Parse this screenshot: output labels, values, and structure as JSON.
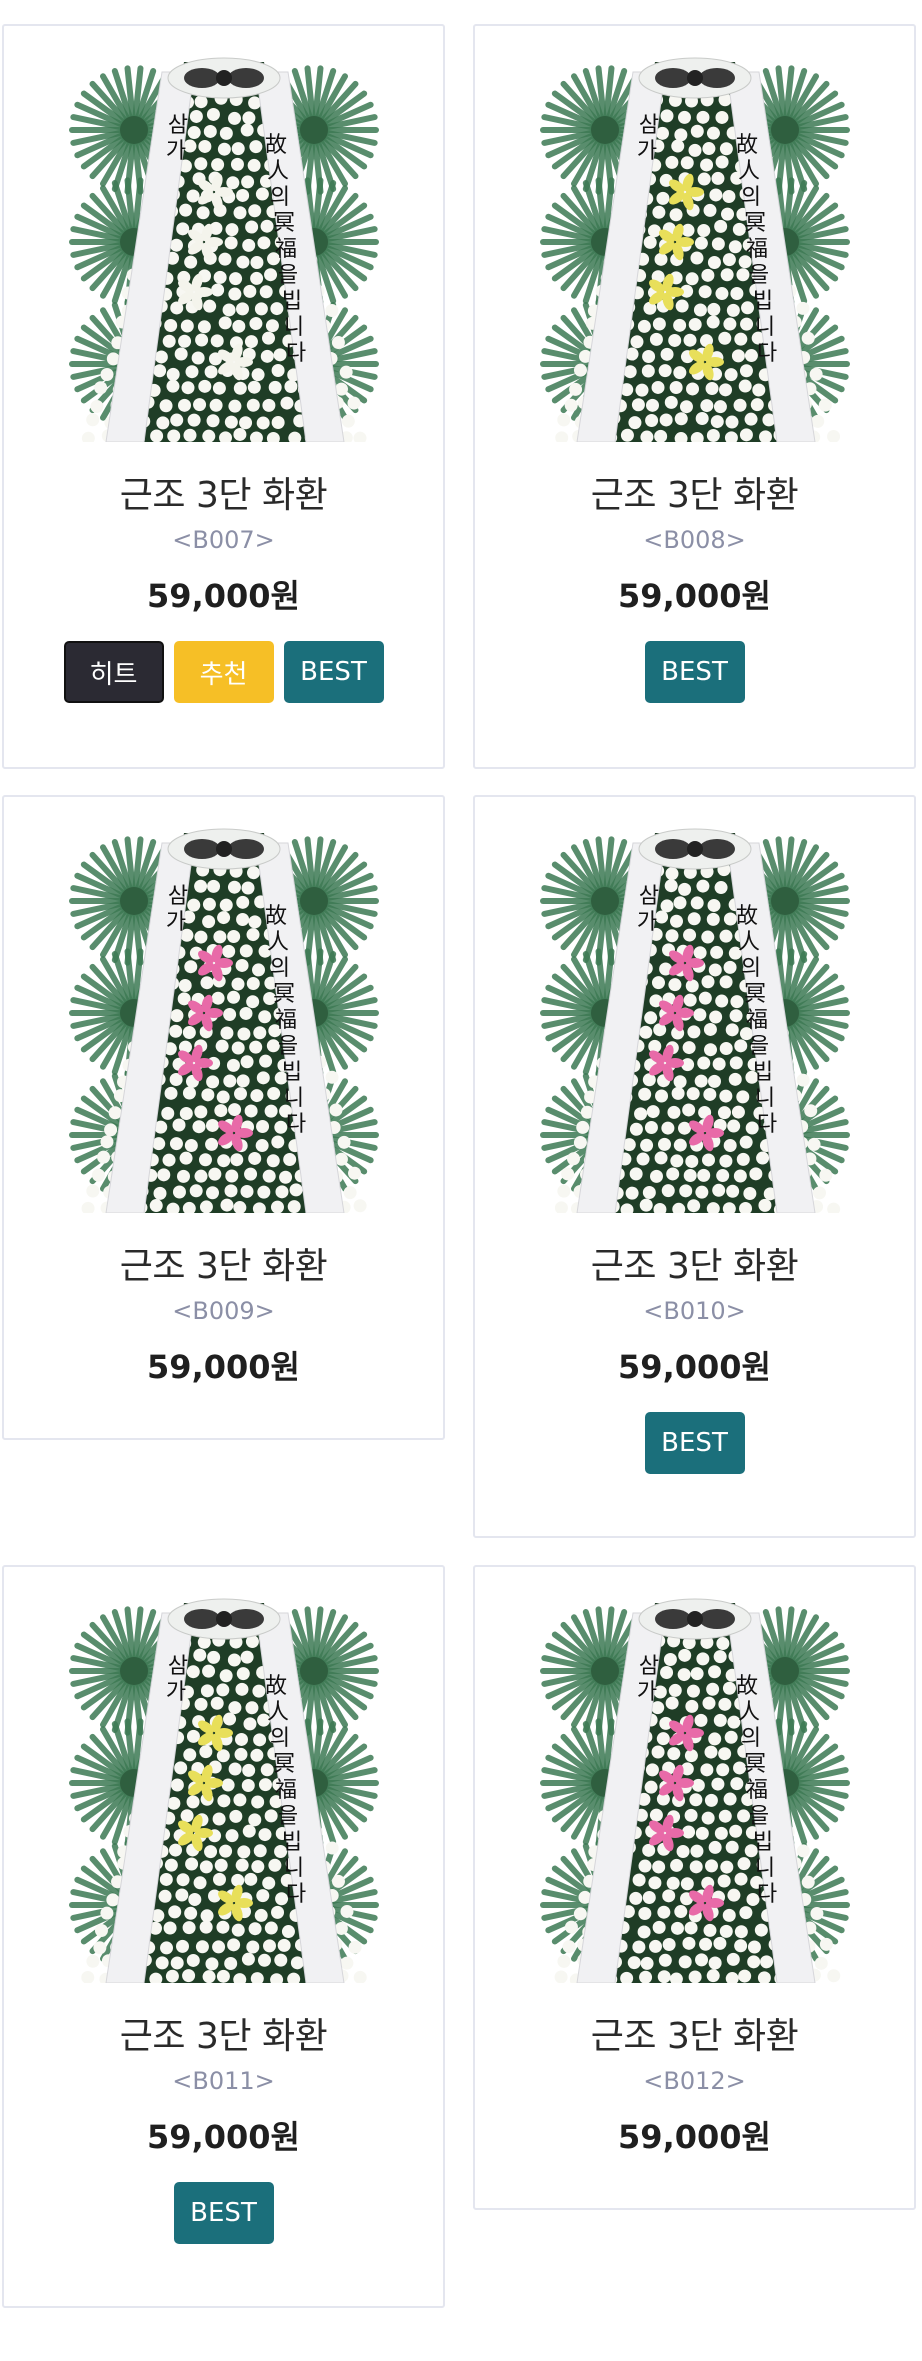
{
  "colors": {
    "hit": "#2b2a33",
    "recommend": "#f6bf26",
    "best": "#1b6f7b",
    "ribbon": "#f1f1f3",
    "fern": "#3d7a54"
  },
  "products": [
    {
      "name": "근조 3단 화환",
      "code": "<B007>",
      "price": "59,000원",
      "badges": [
        {
          "label": "히트",
          "type": "hit"
        },
        {
          "label": "추천",
          "type": "recommend"
        },
        {
          "label": "BEST",
          "type": "best"
        }
      ],
      "flowers": "white-lily"
    },
    {
      "name": "근조 3단 화환",
      "code": "<B008>",
      "price": "59,000원",
      "badges": [
        {
          "label": "BEST",
          "type": "best"
        }
      ],
      "flowers": "yellow-lily"
    },
    {
      "name": "근조 3단 화환",
      "code": "<B009>",
      "price": "59,000원",
      "badges": [],
      "flowers": "pink-lily"
    },
    {
      "name": "근조 3단 화환",
      "code": "<B010>",
      "price": "59,000원",
      "badges": [
        {
          "label": "BEST",
          "type": "best"
        }
      ],
      "flowers": "pink-lily"
    },
    {
      "name": "근조 3단 화환",
      "code": "<B011>",
      "price": "59,000원",
      "badges": [
        {
          "label": "BEST",
          "type": "best"
        }
      ],
      "flowers": "yellow-lily"
    },
    {
      "name": "근조 3단 화환",
      "code": "<B012>",
      "price": "59,000원",
      "badges": [],
      "flowers": "pink-lily"
    }
  ],
  "ribbon_text": {
    "left": "삼가",
    "right": [
      "故人의",
      "冥福을",
      "빕니다"
    ]
  }
}
